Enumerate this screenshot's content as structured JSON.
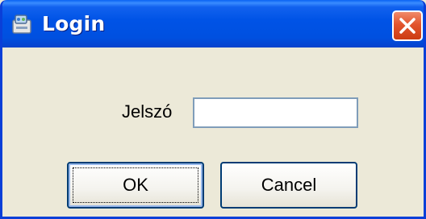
{
  "window": {
    "title": "Login",
    "icon": "app-icon",
    "close_icon": "close-icon",
    "titlebar_color": "#0053e6",
    "close_color": "#e2552e"
  },
  "form": {
    "password_label": "Jelszó",
    "password_value": "",
    "password_placeholder": ""
  },
  "buttons": {
    "ok_label": "OK",
    "cancel_label": "Cancel"
  }
}
